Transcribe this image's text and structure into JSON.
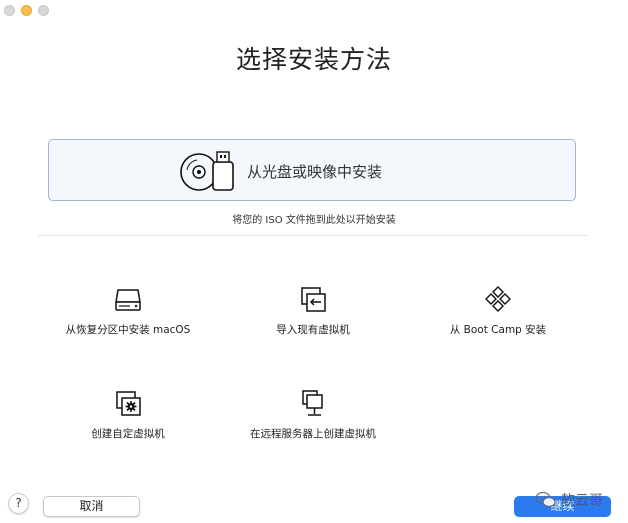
{
  "window": {
    "controls": [
      "close",
      "minimize",
      "zoom"
    ]
  },
  "page": {
    "title": "选择安装方法"
  },
  "dropzone": {
    "label": "从光盘或映像中安装",
    "hint": "将您的 ISO 文件拖到此处以开始安装",
    "icon": "disc-usb-icon"
  },
  "options": [
    {
      "label": "从恢复分区中安装 macOS",
      "icon": "hard-drive-icon"
    },
    {
      "label": "导入现有虚拟机",
      "icon": "import-vm-icon"
    },
    {
      "label": "从 Boot Camp 安装",
      "icon": "bootcamp-diamond-icon"
    },
    {
      "label": "创建自定虚拟机",
      "icon": "custom-vm-icon"
    },
    {
      "label": "在远程服务器上创建虚拟机",
      "icon": "remote-server-icon"
    }
  ],
  "footer": {
    "help_label": "?",
    "cancel_label": "取消",
    "continue_label": "继续"
  },
  "watermark": {
    "text": "软云哥"
  },
  "colors": {
    "accent": "#2b7bf0",
    "dropzone_border": "#9fb7d6",
    "dropzone_bg": "#f4f7fc"
  }
}
